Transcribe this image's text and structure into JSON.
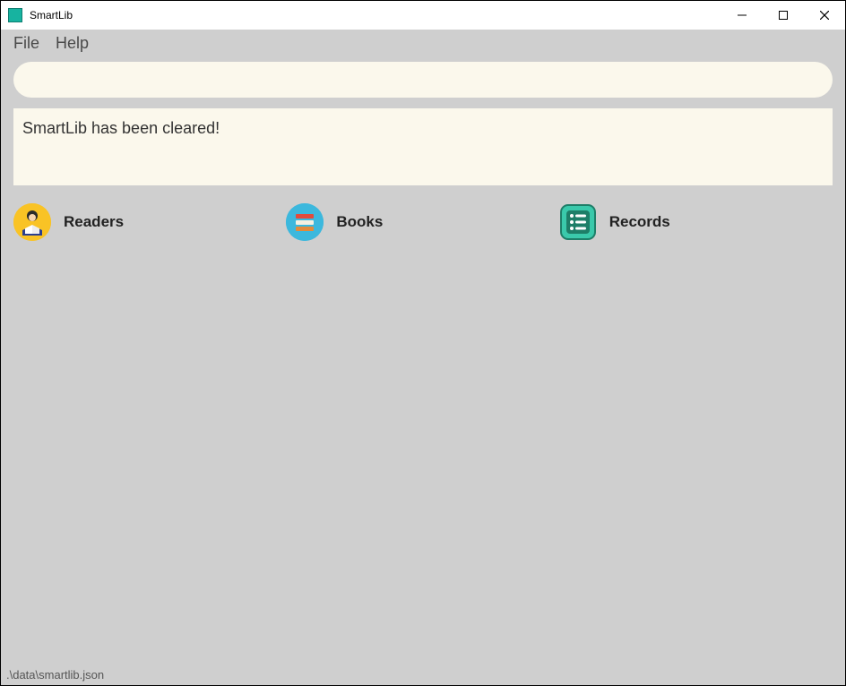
{
  "window": {
    "title": "SmartLib"
  },
  "menu": {
    "items": [
      "File",
      "Help"
    ]
  },
  "search": {
    "value": ""
  },
  "message": {
    "text": "SmartLib has been cleared!"
  },
  "sections": [
    {
      "label": "Readers"
    },
    {
      "label": "Books"
    },
    {
      "label": "Records"
    }
  ],
  "statusbar": {
    "path": ".\\data\\smartlib.json"
  }
}
